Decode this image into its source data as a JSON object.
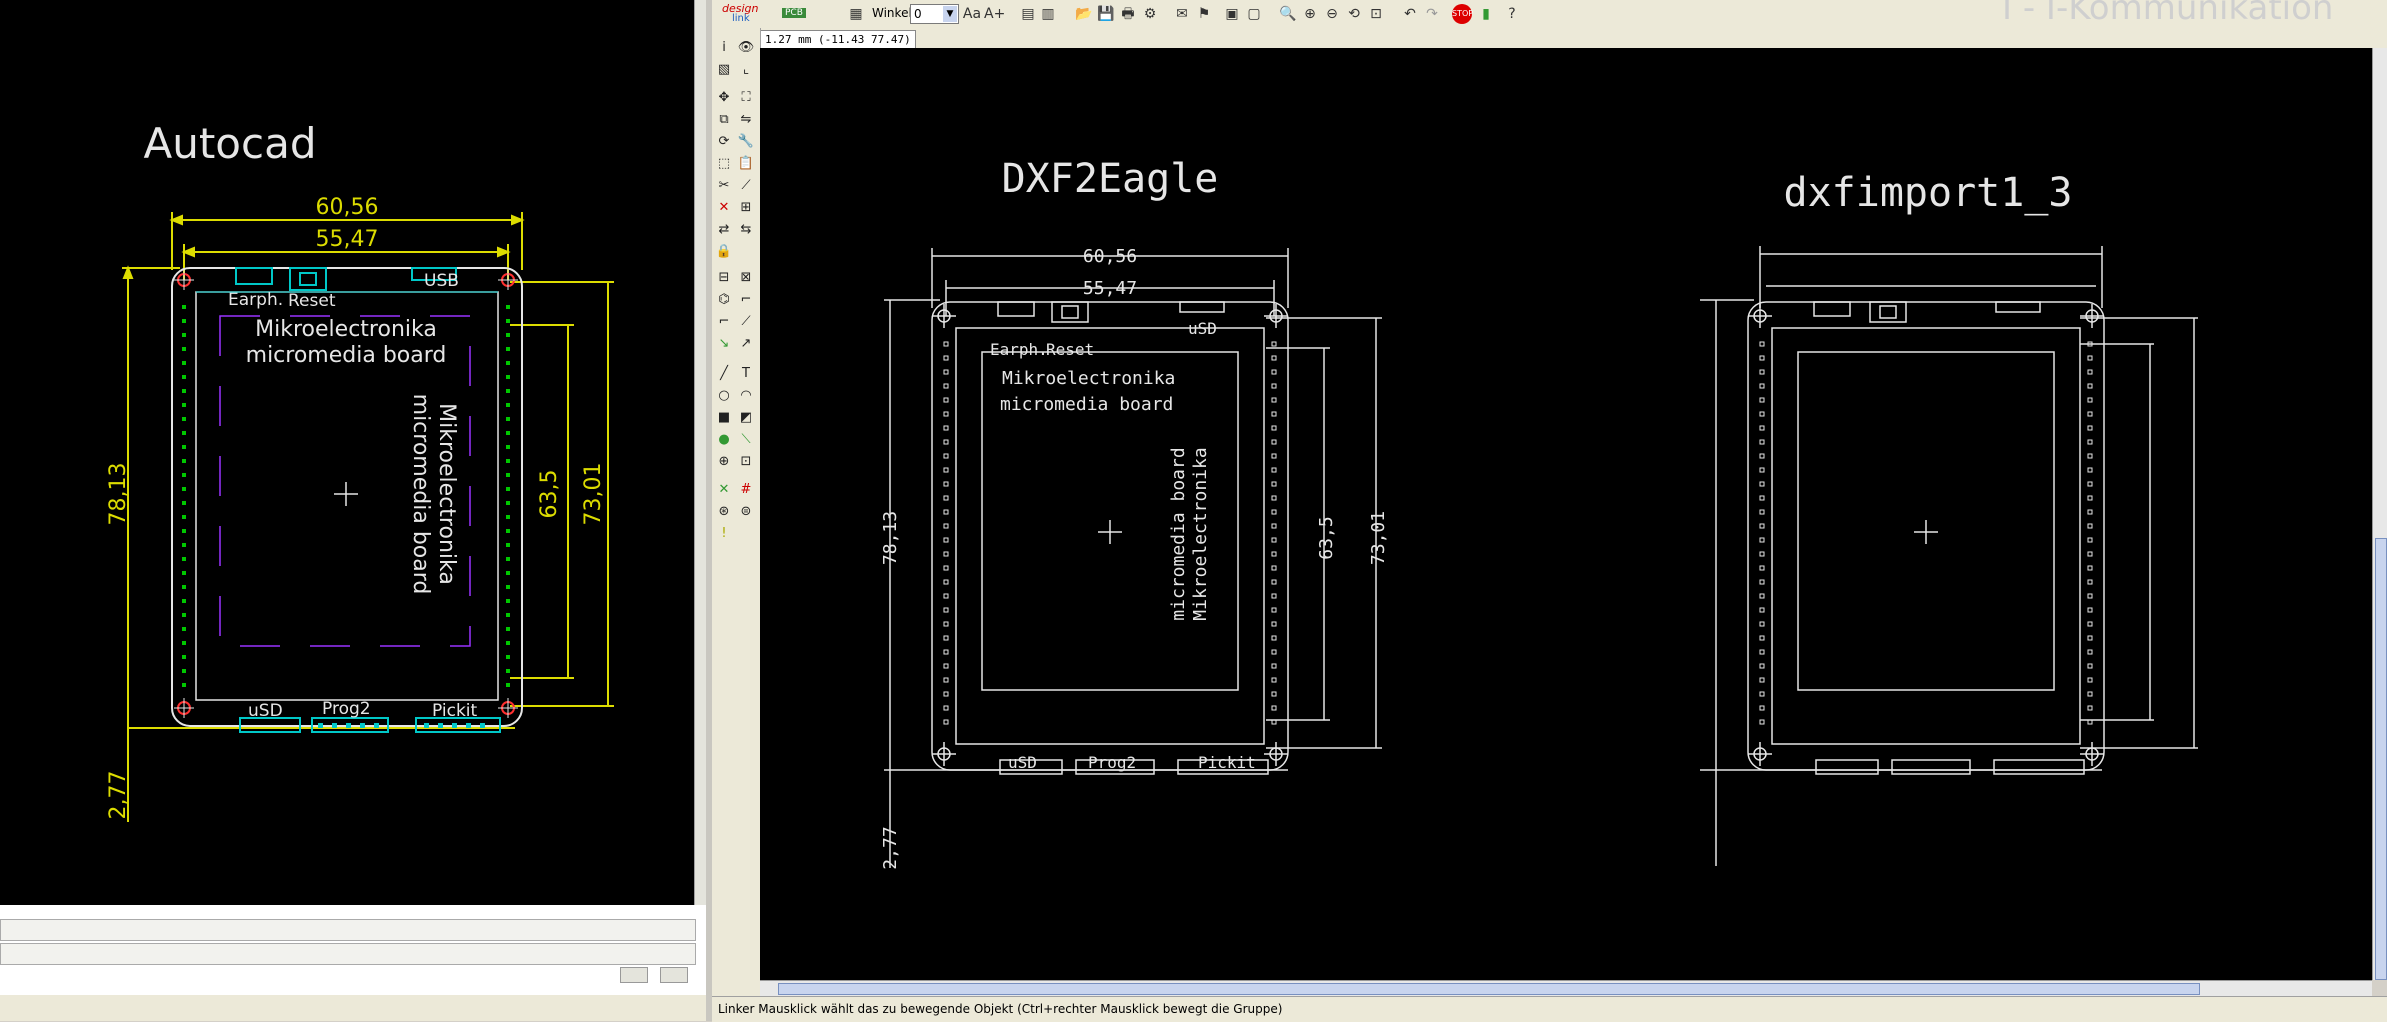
{
  "left_drawing": {
    "title": "Autocad",
    "dim_top_outer": "60,56",
    "dim_top_inner": "55,47",
    "dim_left": "78,13",
    "dim_right_inner": "63,5",
    "dim_right_outer": "73,01",
    "dim_bottom": "2,77",
    "label_earph": "Earph.",
    "label_reset": "Reset",
    "label_usb": "USB",
    "board_line1": "Mikroelectronika",
    "board_line2": "micromedia board",
    "label_usd": "uSD",
    "label_prog2": "Prog2",
    "label_pickit": "Pickit"
  },
  "toolbar": {
    "angle_label": "Winkel:",
    "angle_value": "0",
    "title_faded": "I - I-Kommunikation",
    "logo1": "design",
    "logo2": "link",
    "logo3": "PCB"
  },
  "coordinate_display": "1.27 mm (-11.43 77.47)",
  "drawing2": {
    "title": "DXF2Eagle",
    "dim_top_outer": "60,56",
    "dim_top_inner": "55,47",
    "dim_left": "78,13",
    "dim_right_inner": "63,5",
    "dim_right_outer": "73,01",
    "dim_bottom": "2,77",
    "label_earph": "Earph.",
    "label_reset": "Reset",
    "label_usd_top": "uSD",
    "board_line1": "Mikroelectronika",
    "board_line2": "micromedia board",
    "label_usd": "uSD",
    "label_prog2": "Prog2",
    "label_pickit": "Pickit"
  },
  "drawing3": {
    "title": "dxfimport1_3"
  },
  "status_text": "Linker Mausklick wählt das zu bewegende Objekt (Ctrl+rechter Mausklick bewegt die Gruppe)",
  "colors": {
    "yellow": "#dcdc00",
    "red": "#ff3030",
    "purple": "#9933ff",
    "cyan": "#00c8c8",
    "green": "#00c800"
  }
}
